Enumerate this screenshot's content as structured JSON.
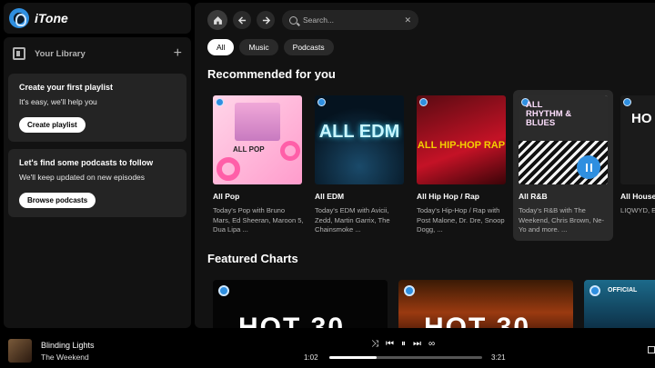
{
  "app": {
    "name": "iTone"
  },
  "library": {
    "title": "Your Library",
    "cards": [
      {
        "title": "Create your first playlist",
        "subtitle": "It's easy, we'll help you",
        "button": "Create playlist"
      },
      {
        "title": "Let's find some podcasts to follow",
        "subtitle": "We'll keep updated on new episodes",
        "button": "Browse podcasts"
      }
    ]
  },
  "search": {
    "placeholder": "Search..."
  },
  "filters": [
    "All",
    "Music",
    "Podcasts"
  ],
  "sections": {
    "recommended": "Recommended for you",
    "featured": "Featured Charts"
  },
  "playlists": [
    {
      "title": "All Pop",
      "desc": "Today's Pop with Bruno Mars, Ed Sheeran, Maroon 5, Dua Lipa ...",
      "cover_text": "ALL POP"
    },
    {
      "title": "All EDM",
      "desc": "Today's EDM with Avicii, Zedd, Martin Garrix, The Chainsmoke ...",
      "cover_text": "ALL EDM"
    },
    {
      "title": "All Hip Hop / Rap",
      "desc": "Today's Hip-Hop / Rap with Post Malone, Dr. Dre, Snoop Dogg, ...",
      "cover_text": "ALL HIP-HOP RAP"
    },
    {
      "title": "All R&B",
      "desc": "Today's R&B with The Weekend, Chris Brown, Ne-Yo and more. ...",
      "cover_text": "ALL RHYTHM & BLUES"
    },
    {
      "title": "All House",
      "desc": "LIQWYD, E Chills, Day",
      "cover_text": "HO"
    }
  ],
  "charts": [
    {
      "cover_text": "HOT 30"
    },
    {
      "cover_text": "HOT 30"
    },
    {
      "cover_text": "OFFICIAL"
    }
  ],
  "player": {
    "title": "Blinding Lights",
    "artist": "The Weekend",
    "elapsed": "1:02",
    "duration": "3:21",
    "progress": 0.31
  },
  "colors": {
    "accent": "#2f8fe0",
    "panel": "#121212",
    "background": "#000000"
  }
}
